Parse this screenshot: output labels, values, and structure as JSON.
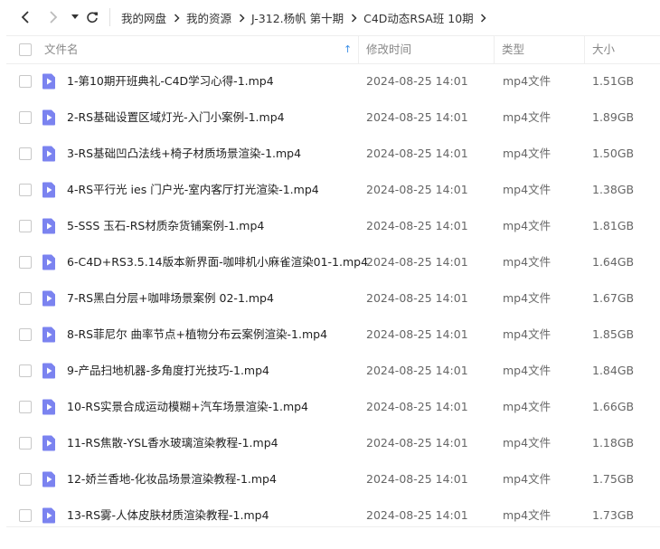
{
  "toolbar": {
    "breadcrumbs": [
      "我的网盘",
      "我的资源",
      "J-312.杨帆 第十期",
      "C4D动态RSA班 10期"
    ]
  },
  "columns": {
    "name": "文件名",
    "modified": "修改时间",
    "type": "类型",
    "size": "大小",
    "sort_indicator": "↑"
  },
  "colors": {
    "file_icon": "#7b83f0",
    "sort_arrow": "#3a8ee6"
  },
  "files": [
    {
      "name": "1-第10期开班典礼-C4D学习心得-1.mp4",
      "modified": "2024-08-25 14:01",
      "type": "mp4文件",
      "size": "1.51GB"
    },
    {
      "name": "2-RS基础设置区域灯光-入门小案例-1.mp4",
      "modified": "2024-08-25 14:01",
      "type": "mp4文件",
      "size": "1.89GB"
    },
    {
      "name": "3-RS基础凹凸法线+椅子材质场景渲染-1.mp4",
      "modified": "2024-08-25 14:01",
      "type": "mp4文件",
      "size": "1.50GB"
    },
    {
      "name": "4-RS平行光 ies 门户光-室内客厅打光渲染-1.mp4",
      "modified": "2024-08-25 14:01",
      "type": "mp4文件",
      "size": "1.38GB"
    },
    {
      "name": "5-SSS 玉石-RS材质杂货铺案例-1.mp4",
      "modified": "2024-08-25 14:01",
      "type": "mp4文件",
      "size": "1.81GB"
    },
    {
      "name": "6-C4D+RS3.5.14版本新界面-咖啡机小麻雀渲染01-1.mp4",
      "modified": "2024-08-25 14:01",
      "type": "mp4文件",
      "size": "1.64GB"
    },
    {
      "name": "7-RS黑白分层+咖啡场景案例 02-1.mp4",
      "modified": "2024-08-25 14:01",
      "type": "mp4文件",
      "size": "1.67GB"
    },
    {
      "name": "8-RS菲尼尔 曲率节点+植物分布云案例渲染-1.mp4",
      "modified": "2024-08-25 14:01",
      "type": "mp4文件",
      "size": "1.85GB"
    },
    {
      "name": "9-产品扫地机器-多角度打光技巧-1.mp4",
      "modified": "2024-08-25 14:01",
      "type": "mp4文件",
      "size": "1.84GB"
    },
    {
      "name": "10-RS实景合成运动模糊+汽车场景渲染-1.mp4",
      "modified": "2024-08-25 14:01",
      "type": "mp4文件",
      "size": "1.66GB"
    },
    {
      "name": "11-RS焦散-YSL香水玻璃渲染教程-1.mp4",
      "modified": "2024-08-25 14:01",
      "type": "mp4文件",
      "size": "1.18GB"
    },
    {
      "name": "12-娇兰香地-化妆品场景渲染教程-1.mp4",
      "modified": "2024-08-25 14:01",
      "type": "mp4文件",
      "size": "1.75GB"
    },
    {
      "name": "13-RS雾-人体皮肤材质渲染教程-1.mp4",
      "modified": "2024-08-25 14:01",
      "type": "mp4文件",
      "size": "1.73GB"
    }
  ]
}
